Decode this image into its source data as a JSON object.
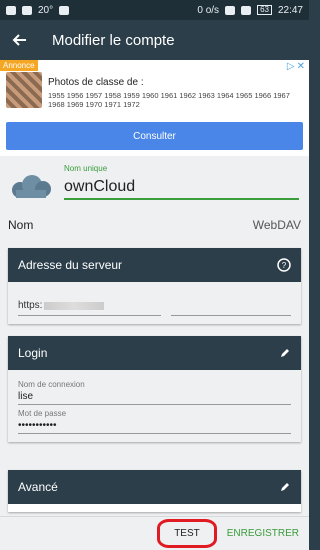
{
  "status": {
    "speed": "0 o/s",
    "battery": "63",
    "time": "22:47",
    "temp": "20°"
  },
  "appbar": {
    "title": "Modifier le compte"
  },
  "ad": {
    "badge": "Annonce",
    "title": "Photos de classe de :",
    "years": "1955 1956 1957 1958 1959 1960 1961 1962 1963 1964 1965 1966 1967 1968 1969 1970 1971 1972",
    "button": "Consulter"
  },
  "account": {
    "unique_label": "Nom unique",
    "unique_value": "ownCloud",
    "nom_label": "Nom",
    "nom_value": "WebDAV"
  },
  "server_card": {
    "title": "Adresse du serveur",
    "value_prefix": "https:"
  },
  "login_card": {
    "title": "Login",
    "user_label": "Nom de connexion",
    "user_value": "lise",
    "pass_label": "Mot de passe",
    "pass_value": "•••••••••••"
  },
  "advanced_card": {
    "title": "Avancé"
  },
  "actions": {
    "test": "TEST",
    "save": "ENREGISTRER"
  },
  "colors": {
    "primary": "#2b3e4a",
    "accent": "#3a9c3a",
    "highlight": "#e01b24",
    "ad_button": "#4a86e8"
  }
}
